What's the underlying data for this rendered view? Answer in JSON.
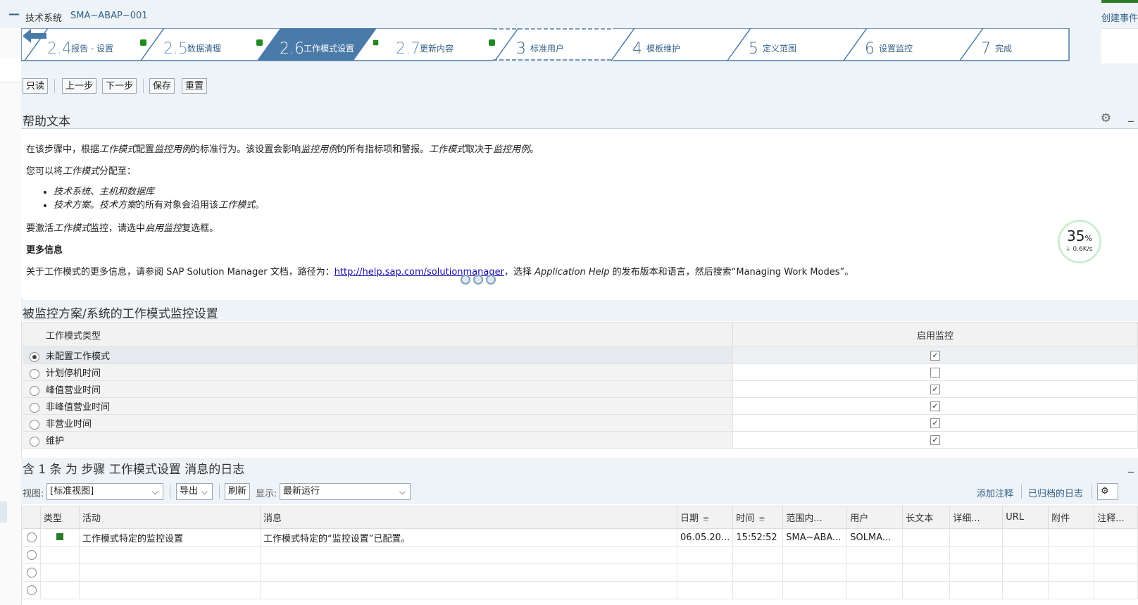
{
  "header": {
    "label": "技术系统",
    "system": "SMA~ABAP~001",
    "create_event": "创建事件"
  },
  "wizard": {
    "steps": [
      {
        "num": "2.4",
        "label": "报告 - 设置",
        "state": "done"
      },
      {
        "num": "2.5",
        "label": "数据清理",
        "state": "done"
      },
      {
        "num": "2.6",
        "label": "工作模式设置",
        "state": "active"
      },
      {
        "num": "2.7",
        "label": "更新内容",
        "state": "done"
      },
      {
        "num": "3",
        "label": "标准用户",
        "state": "pending"
      },
      {
        "num": "4",
        "label": "模板维护",
        "state": "pending"
      },
      {
        "num": "5",
        "label": "定义范围",
        "state": "pending"
      },
      {
        "num": "6",
        "label": "设置监控",
        "state": "pending"
      },
      {
        "num": "7",
        "label": "完成",
        "state": "pending"
      }
    ],
    "colors": {
      "active": "#4a7aa8",
      "done_dot": "#1f8a1f",
      "line": "#4a7aa8"
    }
  },
  "toolbar": {
    "readonly": "只读",
    "prev": "上一步",
    "next": "下一步",
    "save": "保存",
    "reset": "重置"
  },
  "help": {
    "title": "帮助文本",
    "p1_a": "在该步骤中，根据",
    "p1_b": "工作模式",
    "p1_c": "配置",
    "p1_d": "监控用例",
    "p1_e": "的标准行为。该设置会影响",
    "p1_f": "监控用例",
    "p1_g": "的所有指标项和警报。",
    "p1_h": "工作模式",
    "p1_i": "取决于",
    "p1_j": "监控用例",
    "p1_k": "。",
    "p2_a": "您可以将",
    "p2_b": "工作模式",
    "p2_c": "分配至：",
    "li1": "技术系统、主机和数据库",
    "li2_a": "技术方案",
    "li2_b": "。",
    "li2_c": "技术方案",
    "li2_d": "的所有对象会沿用该",
    "li2_e": "工作模式",
    "li2_f": "。",
    "p3_a": "要激活",
    "p3_b": "工作模式",
    "p3_c": "监控，请选中",
    "p3_d": "启用监控",
    "p3_e": "复选框。",
    "more_title": "更多信息",
    "p4_a": "关于工作模式的更多信息，请参阅 SAP Solution Manager 文档，路径为：",
    "p4_link": "http://help.sap.com/solutionmanager",
    "p4_b": "，选择 ",
    "p4_c": "Application Help",
    "p4_d": " 的发布版本和语言，然后搜索“Managing Work Modes”。"
  },
  "speed_widget": {
    "percent": "35",
    "unit": "%",
    "rate": "0.6K/s",
    "arrow": "↓"
  },
  "workmode": {
    "title": "被监控方案/系统的工作模式监控设置",
    "col_type": "工作模式类型",
    "col_enable": "启用监控",
    "rows": [
      {
        "label": "未配置工作模式",
        "selected": true,
        "checked": true
      },
      {
        "label": "计划停机时间",
        "selected": false,
        "checked": false
      },
      {
        "label": "峰值营业时间",
        "selected": false,
        "checked": true
      },
      {
        "label": "非峰值营业时间",
        "selected": false,
        "checked": true
      },
      {
        "label": "非营业时间",
        "selected": false,
        "checked": true
      },
      {
        "label": "维护",
        "selected": false,
        "checked": true
      }
    ]
  },
  "log": {
    "title": "含 1 条 为 步骤 工作模式设置 消息的日志",
    "view_label": "视图:",
    "view_value": "[标准视图]",
    "export": "导出",
    "refresh": "刷新",
    "show_label": "显示:",
    "show_value": "最新运行",
    "add_note": "添加注释",
    "archived": "已归档的日志",
    "columns": [
      "类型",
      "活动",
      "消息",
      "日期",
      "时间",
      "范围内...",
      "用户",
      "长文本",
      "详细...",
      "URL",
      "附件",
      "注释..."
    ],
    "rows": [
      {
        "type_color": "#2b7d2b",
        "activity": "工作模式特定的监控设置",
        "message": "工作模式特定的“监控设置”已配置。",
        "date": "06.05.20...",
        "time": "15:52:52",
        "scope": "SMA~ABA...",
        "user": "SOLMA..."
      }
    ]
  }
}
